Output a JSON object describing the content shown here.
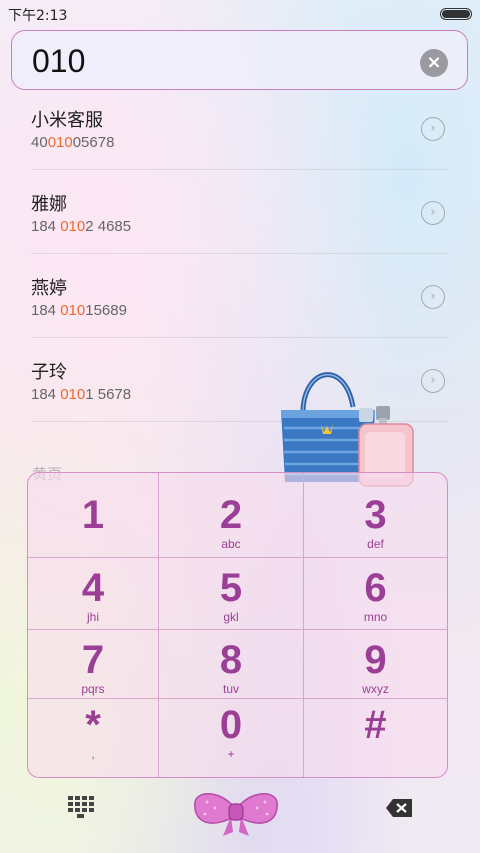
{
  "status_bar": {
    "time": "下午2:13"
  },
  "search": {
    "value": "010",
    "clear_icon": "×"
  },
  "results": [
    {
      "name": "小米客服",
      "number_pre": "40",
      "number_match": "010",
      "number_post": "05678"
    },
    {
      "name": "雅娜",
      "number_pre": "184 ",
      "number_match": "010",
      "number_post": "2 4685"
    },
    {
      "name": "燕婷",
      "number_pre": "184 ",
      "number_match": "010",
      "number_post": "15689"
    },
    {
      "name": "子玲",
      "number_pre": "184 ",
      "number_match": "010",
      "number_post": "1 5678"
    }
  ],
  "more_label": "黄页",
  "detail_icon": "›",
  "keypad": [
    {
      "digit": "1",
      "letters": ""
    },
    {
      "digit": "2",
      "letters": "abc"
    },
    {
      "digit": "3",
      "letters": "def"
    },
    {
      "digit": "4",
      "letters": "jhi"
    },
    {
      "digit": "5",
      "letters": "gkl"
    },
    {
      "digit": "6",
      "letters": "mno"
    },
    {
      "digit": "7",
      "letters": "pqrs"
    },
    {
      "digit": "8",
      "letters": "tuv"
    },
    {
      "digit": "9",
      "letters": "wxyz"
    },
    {
      "digit": "*",
      "letters": ","
    },
    {
      "digit": "0",
      "letters": "+"
    },
    {
      "digit": "#",
      "letters": ""
    }
  ],
  "colors": {
    "accent": "#9b3f96",
    "highlight": "#ec6a2a",
    "border": "#c67fb9"
  },
  "icons": {
    "battery": "battery-icon",
    "clear": "clear-icon",
    "detail": "chevron-right-icon",
    "dialpad": "dialpad-icon",
    "call": "bow-call-icon",
    "backspace": "backspace-icon"
  }
}
